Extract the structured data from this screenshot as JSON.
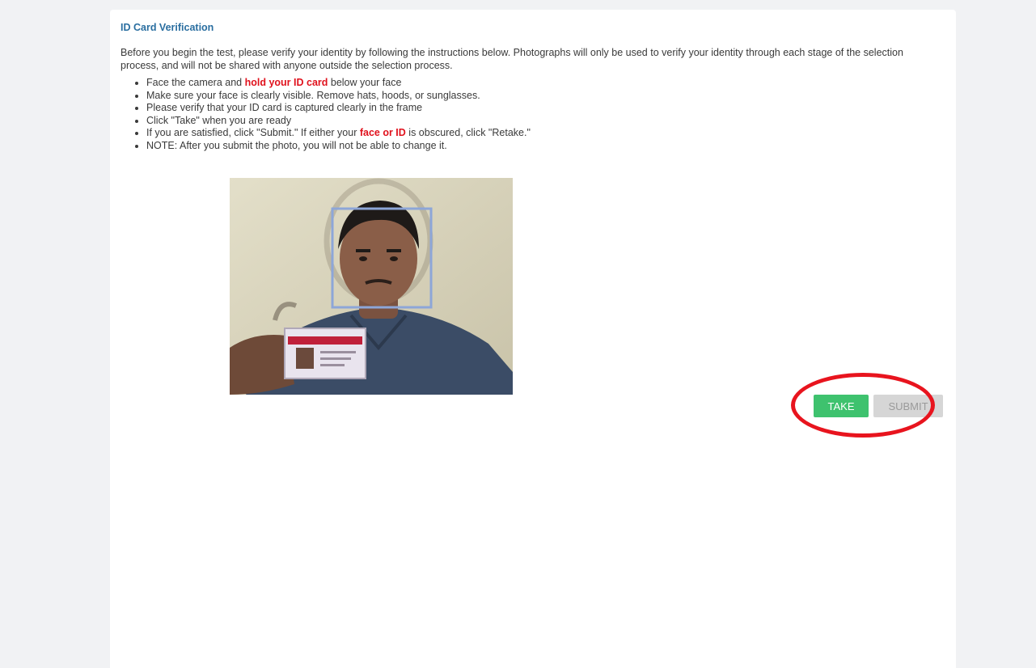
{
  "title": "ID Card Verification",
  "intro": "Before you begin the test, please verify your identity by following the instructions below. Photographs will only be used to verify your identity through each stage of the selection process, and will not be shared with anyone outside the selection process.",
  "instructions": {
    "item1_pre": "Face the camera and ",
    "item1_bold": "hold your ID card",
    "item1_post": " below your face",
    "item2": "Make sure your face is clearly visible. Remove hats, hoods, or sunglasses.",
    "item3": "Please verify that your ID card is captured clearly in the frame",
    "item4": "Click \"Take\" when you are ready",
    "item5_pre": "If you are satisfied, click \"Submit.\" If either your ",
    "item5_bold": "face or ID",
    "item5_post": " is obscured, click \"Retake.\"",
    "item6": "NOTE: After you submit the photo, you will not be able to change it."
  },
  "buttons": {
    "take": "TAKE",
    "submit": "SUBMIT"
  },
  "colors": {
    "title": "#2a6ea0",
    "highlight_text": "#e0121d",
    "take_button": "#3ec26e",
    "submit_button": "#d6d6d6",
    "annotation_ring": "#e8141e"
  },
  "icons": {
    "camera_preview": "webcam-preview",
    "face_guide": "face-frame-guide"
  }
}
